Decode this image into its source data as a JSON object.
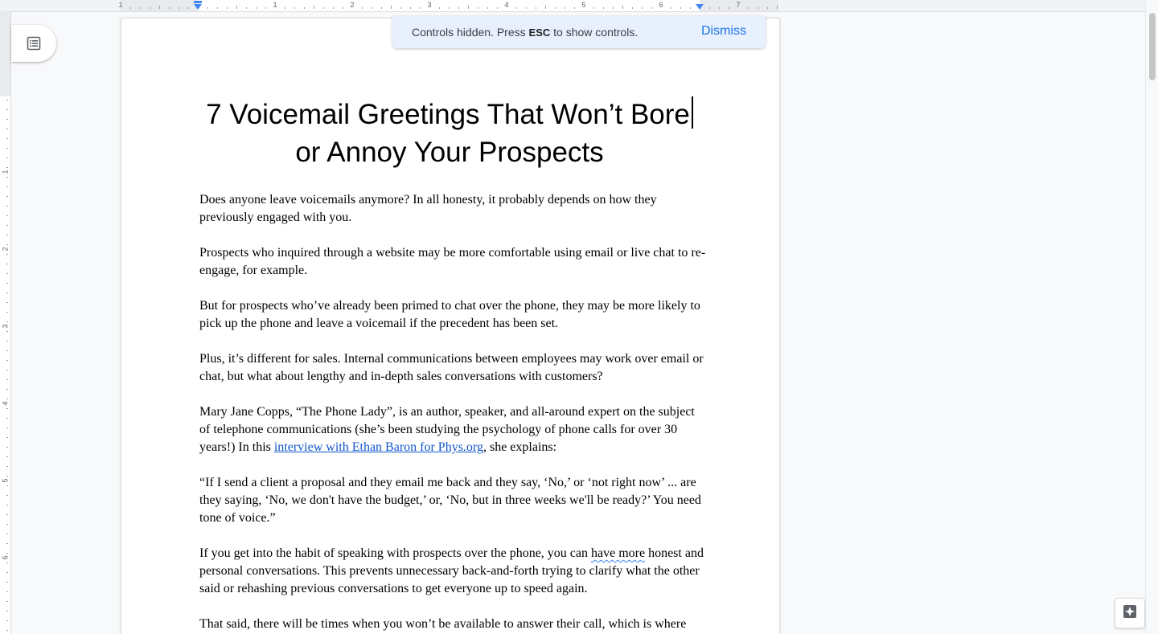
{
  "ruler": {
    "numbers": [
      "1",
      "1",
      "2",
      "3",
      "4",
      "5",
      "6",
      "7"
    ],
    "vertical_numbers": [
      "1",
      "2",
      "3",
      "4",
      "5",
      "6"
    ]
  },
  "outline": {
    "icon": "document-outline-icon"
  },
  "notification": {
    "text_before": "Controls hidden. Press ",
    "key": "ESC",
    "text_after": " to show controls.",
    "dismiss_label": "Dismiss"
  },
  "document": {
    "title_line1": "7 Voicemail Greetings That Won’t Bore",
    "title_line2": "or Annoy Your Prospects",
    "paragraphs": [
      "Does anyone leave voicemails anymore? In all honesty, it probably depends on how they previously engaged with you.",
      "Prospects who inquired through a website may be more comfortable using email or live chat to re-engage, for example.",
      "But for prospects who’ve already been primed to chat over the phone, they may be more likely to pick up the phone and leave a voicemail if the precedent has been set.",
      "Plus, it’s different for sales. Internal communications between employees may work over email or chat, but what about lengthy and in-depth sales conversations with customers?"
    ],
    "para5": {
      "before": "Mary Jane Copps, “The Phone Lady”, is an author, speaker, and all-around expert on the subject of telephone communications (she’s been studying the psychology of phone calls for over 30 years!) In this ",
      "link": "interview with Ethan Baron for Phys.org",
      "after": ", she explains:"
    },
    "para6": "“If I send a client a proposal and they email me back and they say, ‘No,’ or ‘not right now’ ... are they saying, ‘No, we don't have the budget,’ or, ‘No, but in three weeks we'll be ready?’ You need tone of voice.”",
    "para7": {
      "before": "If you get into the habit of speaking with prospects over the phone, you can ",
      "flagged": "have more",
      "after": " honest and personal conversations. This prevents unnecessary back-and-forth trying to clarify what the other said or rehashing previous conversations to get everyone up to speed again."
    },
    "para8": "That said, there will be times when you won’t be available to answer their call, which is where"
  },
  "explore": {
    "icon": "explore-sparkle-icon"
  }
}
